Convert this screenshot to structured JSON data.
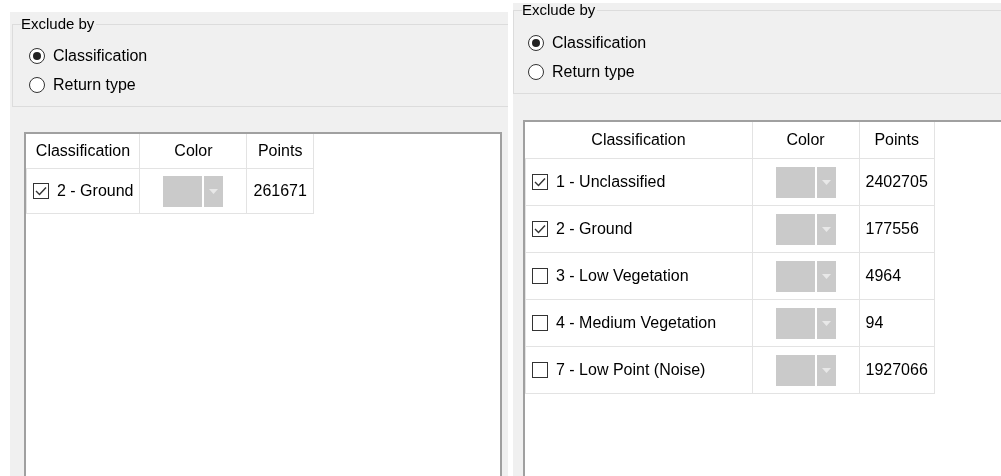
{
  "panels": [
    {
      "legend": "Exclude by",
      "options": [
        {
          "label": "Classification",
          "selected": true
        },
        {
          "label": "Return type",
          "selected": false
        }
      ],
      "table": {
        "columns": [
          "Classification",
          "Color",
          "Points"
        ],
        "rows": [
          {
            "label": "2 - Ground",
            "checked": true,
            "points": "261671"
          }
        ]
      }
    },
    {
      "legend": "Exclude by",
      "options": [
        {
          "label": "Classification",
          "selected": true
        },
        {
          "label": "Return type",
          "selected": false
        }
      ],
      "table": {
        "columns": [
          "Classification",
          "Color",
          "Points"
        ],
        "rows": [
          {
            "label": "1 - Unclassified",
            "checked": true,
            "points": "2402705"
          },
          {
            "label": "2 - Ground",
            "checked": true,
            "points": "177556"
          },
          {
            "label": "3 - Low Vegetation",
            "checked": false,
            "points": "4964"
          },
          {
            "label": "4 - Medium Vegetation",
            "checked": false,
            "points": "94"
          },
          {
            "label": "7 - Low Point (Noise)",
            "checked": false,
            "points": "1927066"
          }
        ]
      }
    }
  ]
}
